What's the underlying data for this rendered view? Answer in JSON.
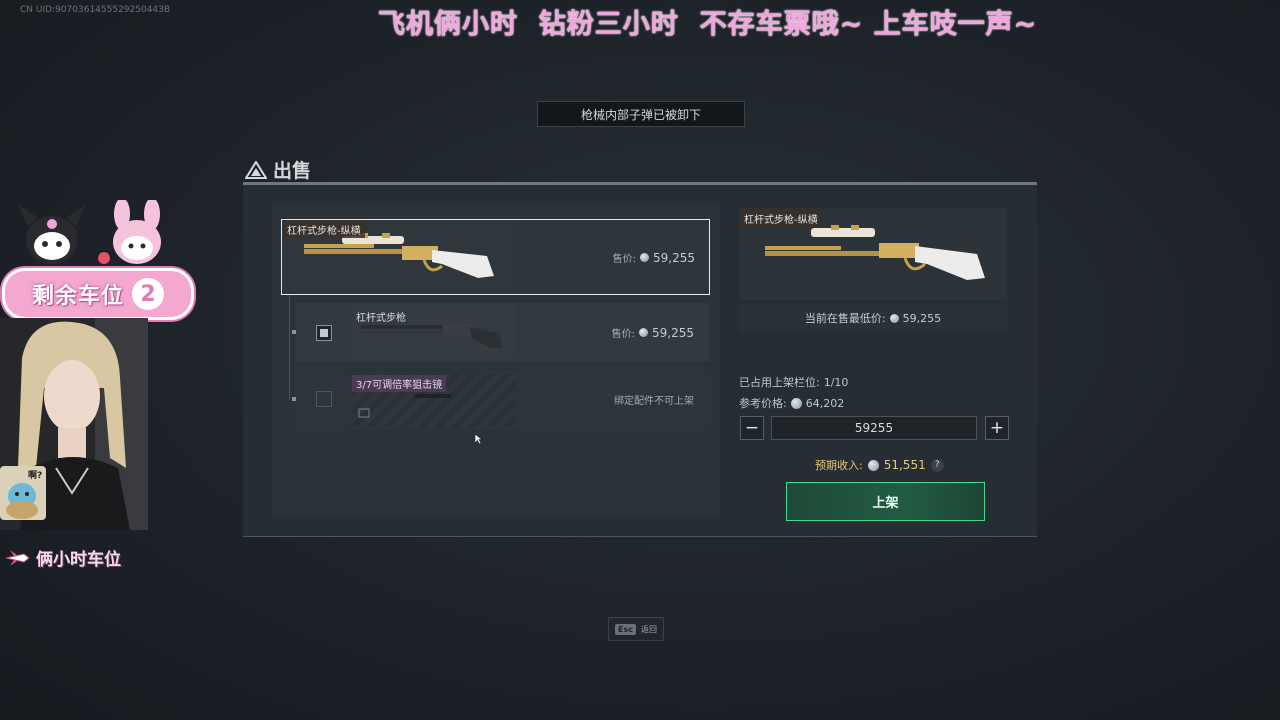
{
  "overlay": {
    "uid": "CN UID:9070361455529250443B",
    "banner": "飞机俩小时  钻粉三小时  不存车票哦~ 上车吱一声~",
    "slots_label": "剩余车位",
    "slots_count": "2",
    "plane_text": "俩小时车位",
    "sticker_text": "啊?"
  },
  "notice": "枪械内部子弹已被卸下",
  "sell": {
    "title": "出售",
    "items": [
      {
        "name": "杠杆式步枪-纵横",
        "price_label": "售价:",
        "price": "59,255",
        "checked": true
      },
      {
        "name": "杠杆式步枪",
        "price_label": "售价:",
        "price": "59,255",
        "checked": true
      },
      {
        "name": "3/7可调倍率狙击镜",
        "status": "绑定配件不可上架",
        "checked": false
      }
    ],
    "detail": {
      "name": "杠杆式步枪-纵横",
      "lowest_label": "当前在售最低价:",
      "lowest_price": "59,255",
      "slots_label": "已占用上架栏位:",
      "slots_value": "1/10",
      "ref_label": "参考价格:",
      "ref_price": "64,202",
      "qty_value": "59255",
      "minus": "−",
      "plus": "+",
      "income_label": "预期收入:",
      "income_value": "51,551",
      "help": "?",
      "list_button": "上架"
    }
  },
  "footer": {
    "esc_key": "Esc",
    "esc_label": "返回"
  },
  "colors": {
    "accent_green": "#44d98e",
    "income_gold": "#e4c978",
    "banner_pink": "#f0a6dc"
  }
}
